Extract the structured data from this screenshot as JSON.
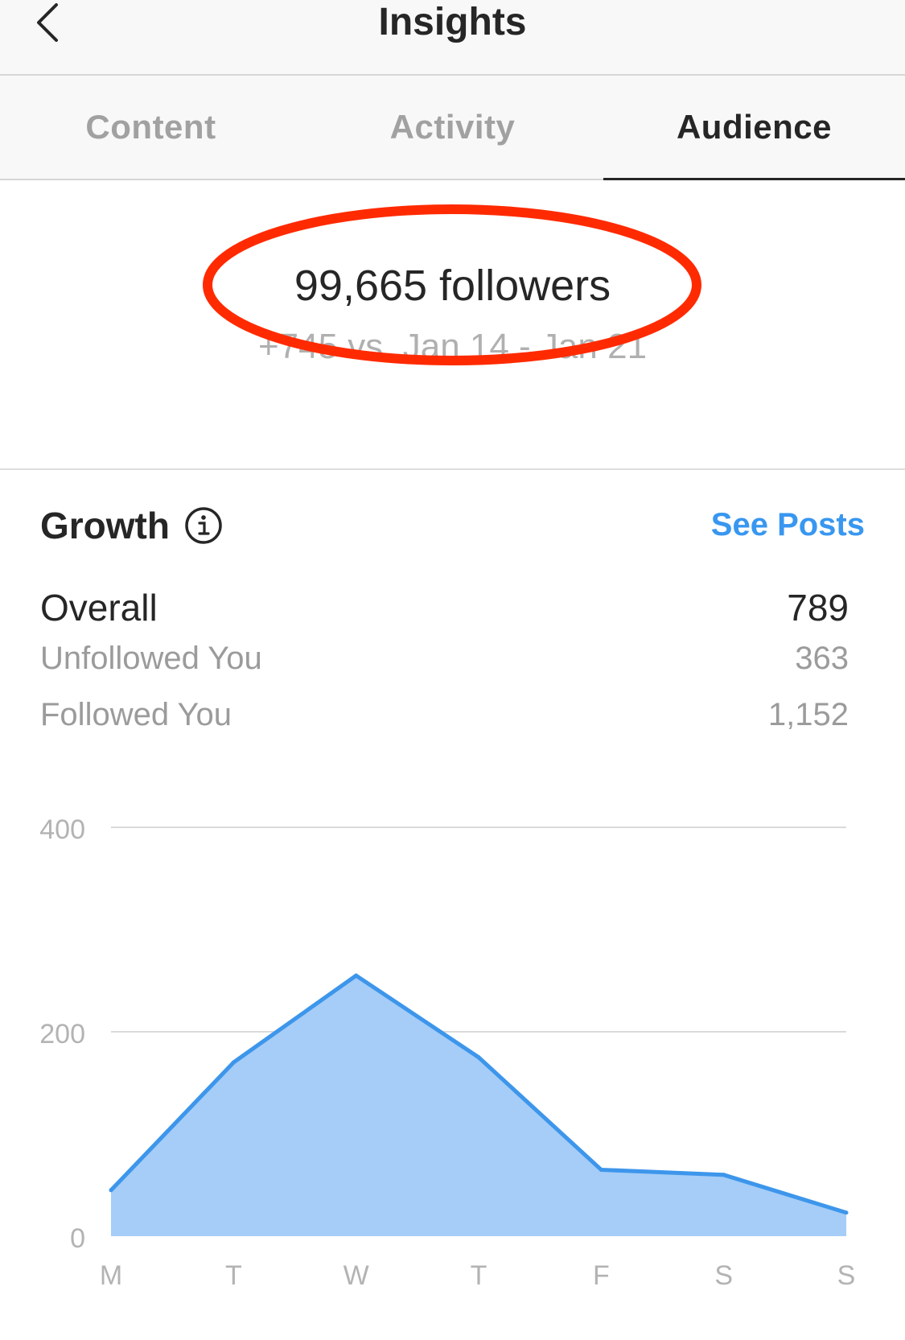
{
  "nav": {
    "title": "Insights",
    "back_icon": "chevron-left-icon"
  },
  "tabs": [
    {
      "label": "Content",
      "active": false
    },
    {
      "label": "Activity",
      "active": false
    },
    {
      "label": "Audience",
      "active": true
    }
  ],
  "summary": {
    "followers": "99,665 followers",
    "delta": "+745 vs. Jan 14 - Jan 21",
    "highlight_color": "#ff2a00"
  },
  "growth": {
    "title": "Growth",
    "info_icon": "info-icon",
    "see_posts": "See Posts",
    "rows": [
      {
        "label": "Overall",
        "value": "789"
      },
      {
        "label": "Unfollowed You",
        "value": "363"
      },
      {
        "label": "Followed You",
        "value": "1,152"
      }
    ]
  },
  "colors": {
    "accent": "#3897f0",
    "chart_fill": "#a5cdf7",
    "chart_line": "#3d96eb"
  },
  "chart_data": {
    "type": "area",
    "categories": [
      "M",
      "T",
      "W",
      "T",
      "F",
      "S",
      "S"
    ],
    "series": [
      {
        "values": [
          45,
          170,
          255,
          175,
          65,
          60,
          23
        ]
      }
    ],
    "yticks": [
      0,
      200,
      400
    ],
    "ylim": [
      0,
      400
    ],
    "grid": true
  }
}
